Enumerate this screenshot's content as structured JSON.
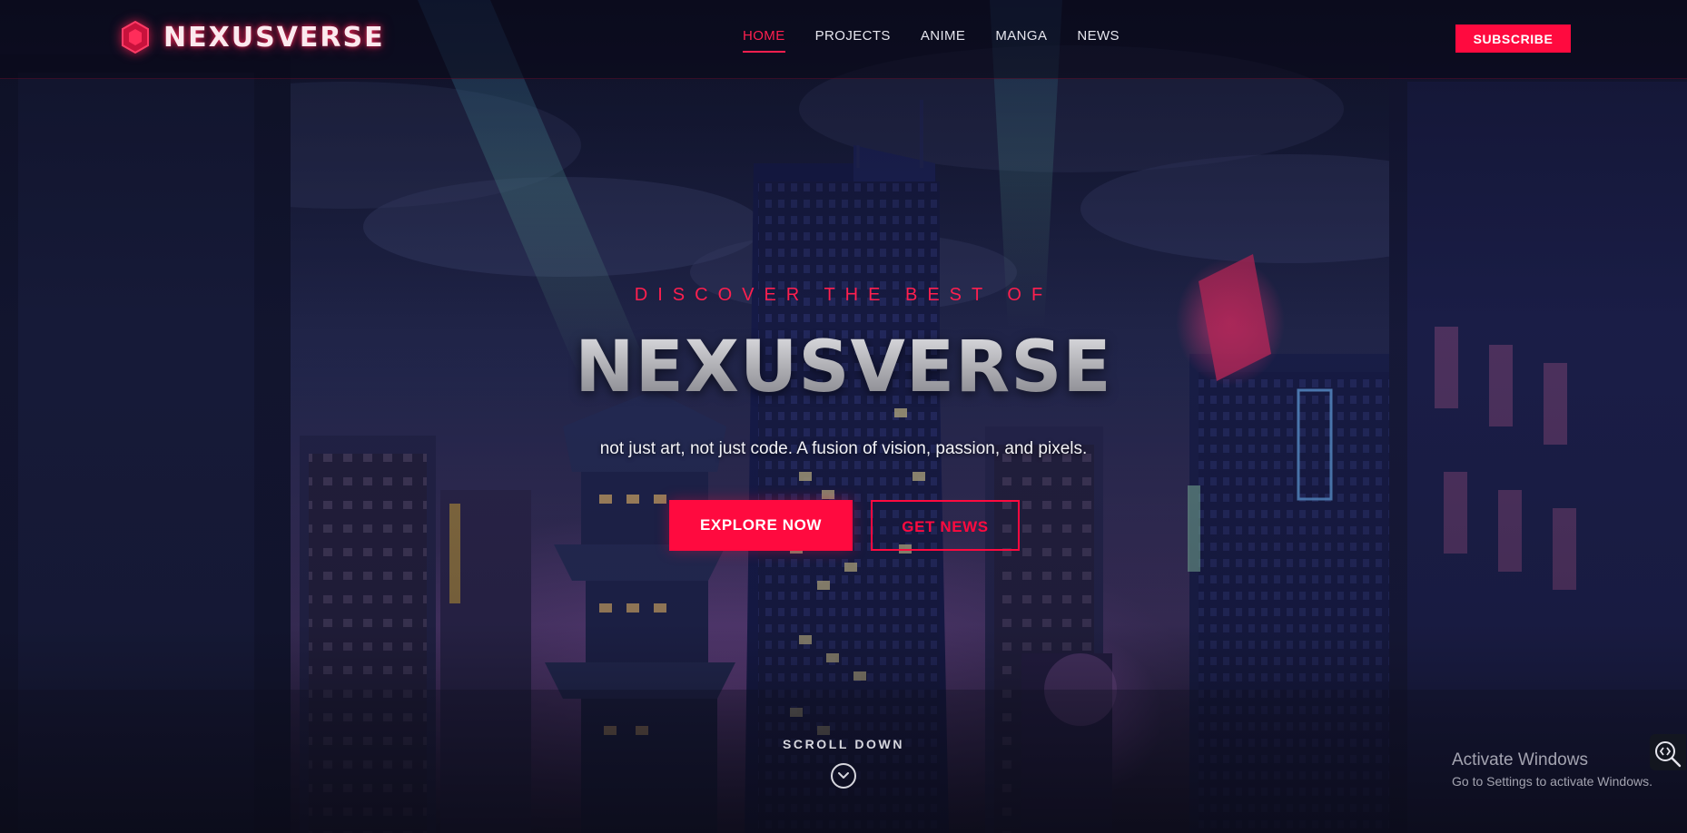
{
  "brand": {
    "name": "NEXUSVERSE",
    "accent_color": "#ff0a3f",
    "logo_icon": "hexagon-icon"
  },
  "nav": {
    "items": [
      {
        "label": "HOME",
        "active": true
      },
      {
        "label": "PROJECTS",
        "active": false
      },
      {
        "label": "ANIME",
        "active": false
      },
      {
        "label": "MANGA",
        "active": false
      },
      {
        "label": "NEWS",
        "active": false
      }
    ],
    "subscribe_label": "SUBSCRIBE"
  },
  "hero": {
    "kicker": "DISCOVER THE BEST OF",
    "title": "NEXUSVERSE",
    "tagline": "not just art, not just code. A fusion of vision, passion, and pixels.",
    "primary_button": "EXPLORE NOW",
    "secondary_button": "GET NEWS",
    "scroll_label": "SCROLL DOWN",
    "scroll_icon": "chevron-down-circle-icon",
    "background": "neon night city skyline"
  },
  "os_overlay": {
    "activation_title": "Activate Windows",
    "activation_sub": "Go to Settings to activate Windows.",
    "tool_icon": "code-search-icon"
  }
}
